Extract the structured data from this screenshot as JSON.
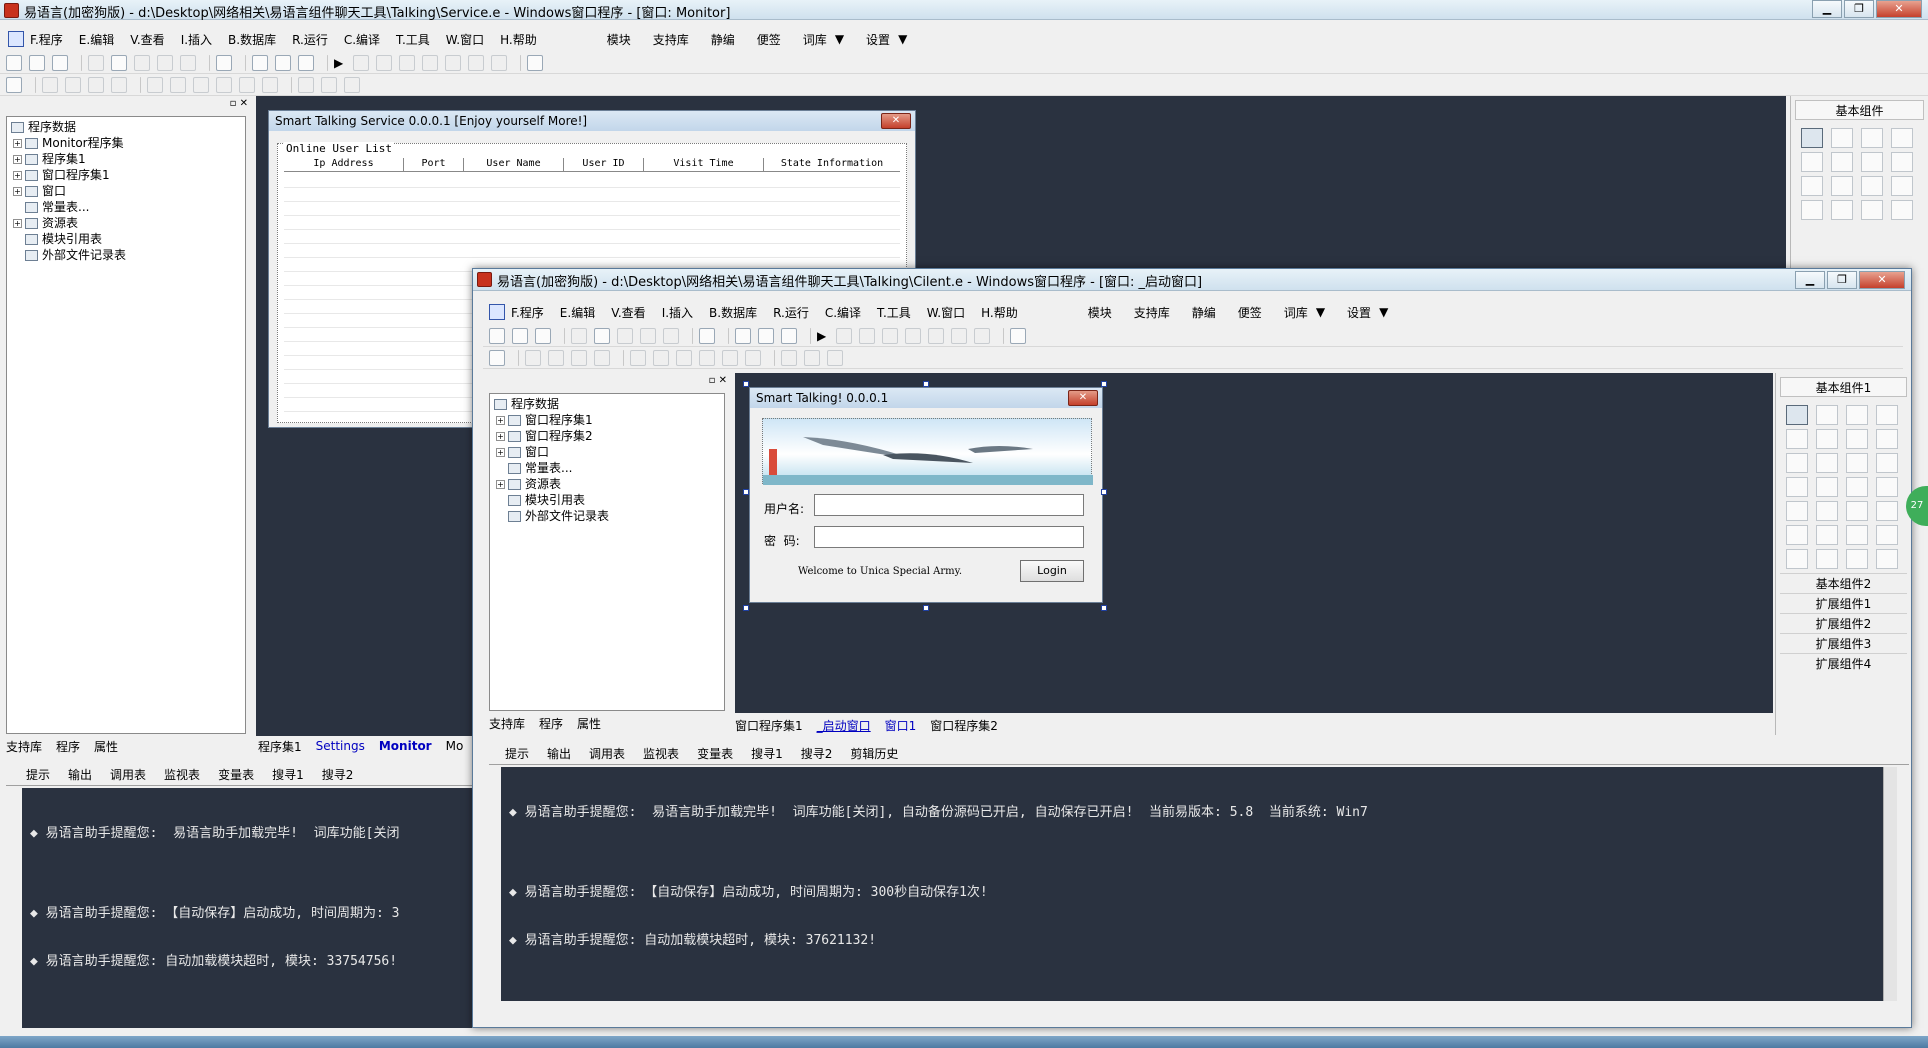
{
  "outer": {
    "title": "易语言(加密狗版) - d:\\Desktop\\网络相关\\易语言组件聊天工具\\Talking\\Service.e - Windows窗口程序 - [窗口: Monitor]",
    "menu": [
      "F.程序",
      "E.编辑",
      "V.查看",
      "I.插入",
      "B.数据库",
      "R.运行",
      "C.编译",
      "T.工具",
      "W.窗口",
      "H.帮助"
    ],
    "menu_right": [
      "模块",
      "支持库",
      "静编",
      "便签",
      "词库",
      "设置"
    ],
    "tree": {
      "root": "程序数据",
      "items": [
        "Monitor程序集",
        "程序集1",
        "窗口程序集1",
        "窗口",
        "常量表...",
        "资源表",
        "模块引用表",
        "外部文件记录表"
      ]
    },
    "left_tabs": [
      "支持库",
      "程序",
      "属性"
    ],
    "editor_tabs": [
      "程序集1",
      "Settings",
      "Monitor",
      "Mo"
    ],
    "output_tabs": [
      "提示",
      "输出",
      "调用表",
      "监视表",
      "变量表",
      "搜寻1",
      "搜寻2"
    ],
    "console": [
      "◆ 易语言助手提醒您:  易语言助手加载完毕!  词库功能[关闭",
      "",
      "◆ 易语言助手提醒您: 【自动保存】启动成功, 时间周期为: 3",
      "◆ 易语言助手提醒您: 自动加载模块超时, 模块: 33754756!"
    ],
    "right_panel": {
      "title": "基本组件"
    },
    "dialog": {
      "title": "Smart Talking Service 0.0.0.1       [Enjoy yourself More!]",
      "group_label": "Online User List",
      "columns": [
        "Ip Address",
        "Port",
        "User Name",
        "User ID",
        "Visit Time",
        "State Information"
      ]
    }
  },
  "inner": {
    "title": "易语言(加密狗版) - d:\\Desktop\\网络相关\\易语言组件聊天工具\\Talking\\Cilent.e - Windows窗口程序 - [窗口: _启动窗口]",
    "menu": [
      "F.程序",
      "E.编辑",
      "V.查看",
      "I.插入",
      "B.数据库",
      "R.运行",
      "C.编译",
      "T.工具",
      "W.窗口",
      "H.帮助"
    ],
    "menu_right": [
      "模块",
      "支持库",
      "静编",
      "便签",
      "词库",
      "设置"
    ],
    "tree": {
      "root": "程序数据",
      "items": [
        "窗口程序集1",
        "窗口程序集2",
        "窗口",
        "常量表...",
        "资源表",
        "模块引用表",
        "外部文件记录表"
      ]
    },
    "left_tabs": [
      "支持库",
      "程序",
      "属性"
    ],
    "editor_tabs": [
      "窗口程序集1",
      "_启动窗口",
      "窗口1",
      "窗口程序集2"
    ],
    "output_tabs": [
      "提示",
      "输出",
      "调用表",
      "监视表",
      "变量表",
      "搜寻1",
      "搜寻2",
      "剪辑历史"
    ],
    "console": [
      "◆ 易语言助手提醒您:  易语言助手加载完毕!  词库功能[关闭], 自动备份源码已开启, 自动保存已开启!  当前易版本: 5.8  当前系统: Win7",
      "",
      "◆ 易语言助手提醒您: 【自动保存】启动成功, 时间周期为: 300秒自动保存1次!",
      "◆ 易语言助手提醒您: 自动加载模块超时, 模块: 37621132!"
    ],
    "right_panel": {
      "title": "基本组件1",
      "categories": [
        "基本组件2",
        "扩展组件1",
        "扩展组件2",
        "扩展组件3",
        "扩展组件4"
      ]
    },
    "login": {
      "title": "Smart Talking! 0.0.0.1",
      "username_label": "用户名:",
      "password_label": "密  码:",
      "username_value": "",
      "password_value": "",
      "welcome": "Welcome to Unica Special Army.",
      "login_button": "Login"
    },
    "side_badge": "27"
  },
  "colors": {
    "dark_bg": "#2a3240",
    "titlebar": "#cfe1ee",
    "close_red": "#c4402b",
    "active_tab": "#0000c0"
  }
}
